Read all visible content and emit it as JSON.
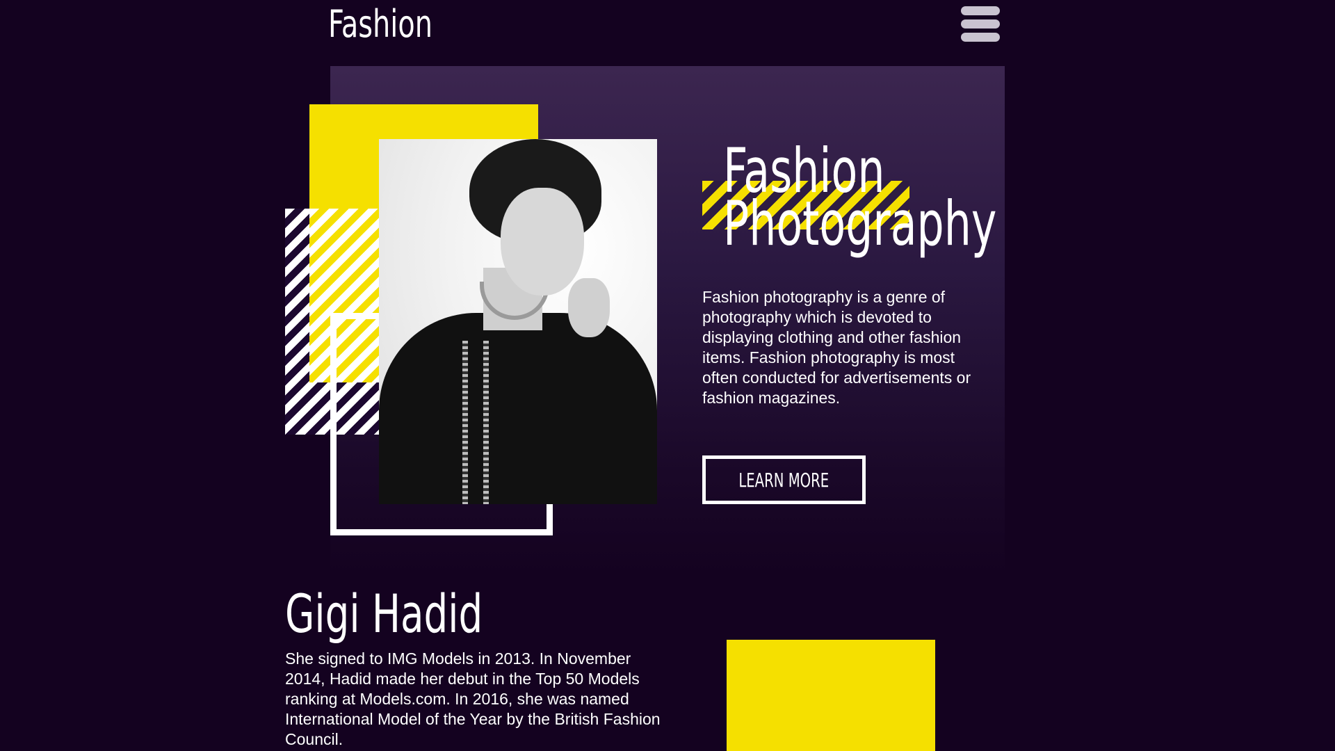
{
  "header": {
    "logo_text": "Fashion",
    "menu_icon": "hamburger-menu-icon"
  },
  "hero": {
    "title_line1": "Fashion",
    "title_line2": "Photography",
    "description": "Fashion photography is a genre of photography which is devoted to displaying clothing and other fashion items. Fashion photography is most often conducted for advertisements or fashion magazines.",
    "button_label": "LEARN MORE",
    "image_description": "black-and-white portrait of a model"
  },
  "feature": {
    "name": "Gigi Hadid",
    "bio": "She signed to IMG Models in 2013. In November 2014, Hadid made her debut in the Top 50 Models ranking at Models.com. In 2016, she was named International Model of the Year by the British Fashion Council."
  },
  "colors": {
    "background": "#140220",
    "card_top": "#3c2650",
    "accent_yellow": "#f5e000",
    "text": "#ffffff",
    "menu_icon": "#c9c3d0"
  }
}
